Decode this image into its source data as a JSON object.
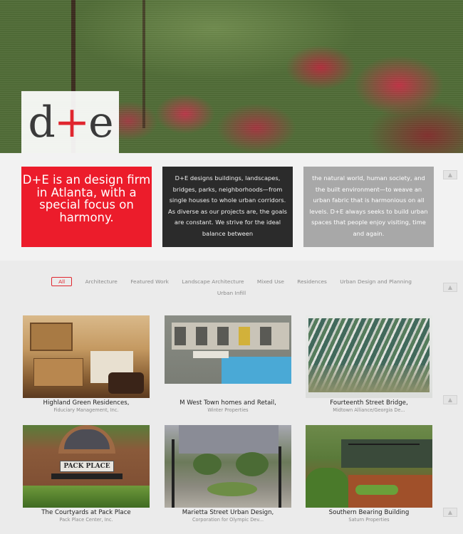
{
  "logo": {
    "text_left": "d",
    "text_plus": "+",
    "text_right": "e"
  },
  "intro": {
    "tagline": "D+E is an design firm in Atlanta, with a special focus on harmony.",
    "about_part1": "D+E designs buildings, landscapes, bridges, parks, neighborhoods—from single houses to whole urban corridors. As diverse as our projects are, the goals are constant. We strive for the ideal balance between",
    "about_part2": "the natural world, human society, and the built environment—to weave an urban fabric that is harmonious on all levels. D+E always seeks to build urban spaces that people enjoy visiting, time and again."
  },
  "filters": [
    "All",
    "Architecture",
    "Featured Work",
    "Landscape Architecture",
    "Mixed Use",
    "Residences",
    "Urban Design and Planning",
    "Urban Infill"
  ],
  "projects": [
    {
      "title": "Highland Green Residences,",
      "client": "Fiduciary Management, Inc."
    },
    {
      "title": "M West Town homes and Retail,",
      "client": "Winter Properties"
    },
    {
      "title": "Fourteenth Street Bridge,",
      "client": "Midtown Alliance/Georgia De..."
    },
    {
      "title": "The Courtyards at Pack Place",
      "client": "Pack Place Center, Inc."
    },
    {
      "title": "Marietta Street Urban Design,",
      "client": "Corporation for Olympic Dev..."
    },
    {
      "title": "Southern Bearing Building",
      "client": "Saturn Properties"
    }
  ],
  "photo_signs": {
    "pack_place": "PACK PLACE"
  },
  "icons": {
    "scroll_up": "chevron-up-icon"
  },
  "colors": {
    "brand_red": "#ec1c2b",
    "dark_panel": "#2b2b2b",
    "gray_panel": "#a8a8a8"
  }
}
